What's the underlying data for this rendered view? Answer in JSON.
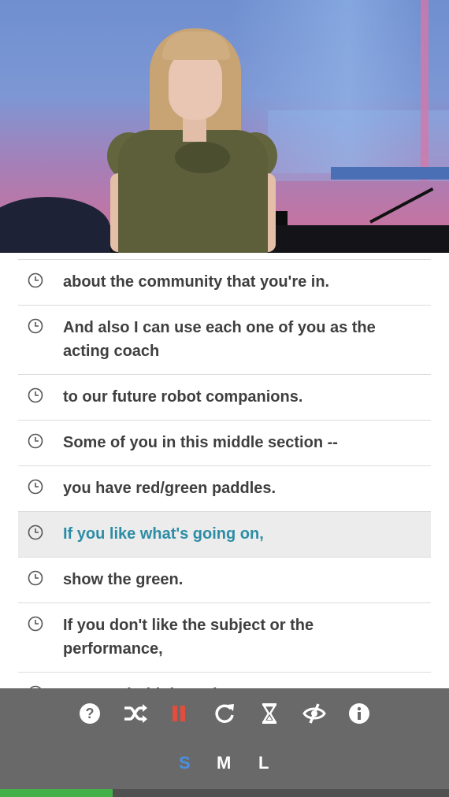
{
  "video": {
    "description_icon": "video-frame"
  },
  "transcript": [
    {
      "text": "about the community that you're in.",
      "active": false
    },
    {
      "text": "And also I can use each one of you as the acting coach",
      "active": false
    },
    {
      "text": "to our future robot companions.",
      "active": false
    },
    {
      "text": "Some of you in this middle section --",
      "active": false
    },
    {
      "text": "you have red/green paddles.",
      "active": false
    },
    {
      "text": "If you like what's going on,",
      "active": true
    },
    {
      "text": "show the green.",
      "active": false
    },
    {
      "text": "If you don't like the subject or the performance,",
      "active": false
    },
    {
      "text": "you can hold the red.",
      "active": false
    }
  ],
  "controls": {
    "icons": [
      "help-icon",
      "shuffle-icon",
      "pause-icon",
      "refresh-icon",
      "hourglass-icon",
      "hide-icon",
      "info-icon"
    ],
    "sizes": [
      "S",
      "M",
      "L"
    ],
    "active_size": "S",
    "colors": {
      "bar": "#696969",
      "icon": "#ffffff",
      "pause": "#e34d3d",
      "active_size": "#4a90e2",
      "active_text": "#2d8ca6",
      "progress": "#44b148"
    }
  },
  "progress": {
    "value": 0.25
  }
}
